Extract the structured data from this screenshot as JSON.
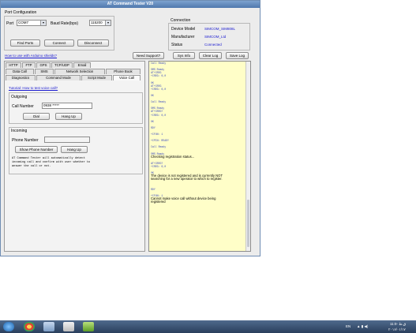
{
  "window": {
    "title": "AT Command Tester V20"
  },
  "port_config": {
    "heading": "Port Configuration",
    "port_label": "Port",
    "port_value": "COM7",
    "baud_label": "Baud Rate(bps)",
    "baud_value": "115200",
    "find_ports": "Find Ports",
    "connect": "Connect",
    "disconnect": "Disconnect"
  },
  "connection": {
    "heading": "Connection",
    "device_model_label": "Device Model",
    "device_model_value": "SIMCOM_SIM808L",
    "manufacturer_label": "Manufacturer",
    "manufacturer_value": "SIMCOM_Ltd",
    "status_label": "Status",
    "status_value": "Connected"
  },
  "toolbar": {
    "arduino_link": "How to use with Arduino shields?",
    "need_support": "Need Support?",
    "sys_info": "Sys Info",
    "clear_log": "Clear Log",
    "save_log": "Save Log"
  },
  "tabs": {
    "row1": [
      "HTTP",
      "FTP",
      "GPS",
      "TCP/UDP",
      "Email"
    ],
    "row2": [
      "Data Call",
      "SMS",
      "Network Selection",
      "Phone Book"
    ],
    "row3": [
      "Diagnostics",
      "Command Mode",
      "Script Mode",
      "Voice Call"
    ]
  },
  "voice_call": {
    "tutorial_link": "Tutorial: How to test voice call?",
    "outgoing_heading": "Outgoing",
    "call_number_label": "Call Number",
    "call_number_value": "0938 *****",
    "dial": "Dial",
    "hang_up": "Hang Up",
    "incoming_heading": "Incoming",
    "phone_number_label": "Phone Number",
    "phone_number_value": "",
    "show_phone_number": "Show Phone Number",
    "hang_up_incoming": "Hang Up",
    "note_1": "AT Command Tester will automatically detect",
    "note_2": "incoming call and confirm with user whether to",
    "note_3": "answer the call or not."
  },
  "log": {
    "lines": [
      {
        "text": "Call Ready",
        "kind": "cmd"
      },
      {
        "text": "",
        "kind": "cmd"
      },
      {
        "text": "SMS Ready",
        "kind": "cmd"
      },
      {
        "text": "AT+CREG",
        "kind": "cmd"
      },
      {
        "text": "+CREG: 0,0",
        "kind": "cmd"
      },
      {
        "text": "",
        "kind": "cmd"
      },
      {
        "text": "OK",
        "kind": "cmd"
      },
      {
        "text": "AT+CREG",
        "kind": "cmd"
      },
      {
        "text": "+CREG: 0,0",
        "kind": "cmd"
      },
      {
        "text": "",
        "kind": "cmd"
      },
      {
        "text": "OK",
        "kind": "cmd"
      },
      {
        "text": "",
        "kind": "cmd"
      },
      {
        "text": "Call Ready",
        "kind": "cmd"
      },
      {
        "text": "",
        "kind": "cmd"
      },
      {
        "text": "SMS Ready",
        "kind": "cmd"
      },
      {
        "text": "AT+CREG?",
        "kind": "cmd"
      },
      {
        "text": "+CREG: 0,0",
        "kind": "cmd"
      },
      {
        "text": "",
        "kind": "cmd"
      },
      {
        "text": "OK",
        "kind": "cmd"
      },
      {
        "text": "",
        "kind": "cmd"
      },
      {
        "text": "RDY",
        "kind": "cmd"
      },
      {
        "text": "",
        "kind": "cmd"
      },
      {
        "text": "+CFUN: 1",
        "kind": "cmd"
      },
      {
        "text": "",
        "kind": "cmd"
      },
      {
        "text": "+CPIN: READY",
        "kind": "cmd"
      },
      {
        "text": "",
        "kind": "cmd"
      },
      {
        "text": "Call Ready",
        "kind": "cmd"
      },
      {
        "text": "",
        "kind": "cmd"
      },
      {
        "text": "SMS Ready",
        "kind": "cmd"
      },
      {
        "text": "Checking registration status...",
        "kind": "msg"
      },
      {
        "text": "",
        "kind": "cmd"
      },
      {
        "text": "AT+CREG?",
        "kind": "cmd"
      },
      {
        "text": "+CREG: 0,0",
        "kind": "cmd"
      },
      {
        "text": "",
        "kind": "cmd"
      },
      {
        "text": "OK",
        "kind": "cmd"
      },
      {
        "text": "The device is not registered and is currently NOT",
        "kind": "msg"
      },
      {
        "text": "searching for a new operator to which to register.",
        "kind": "msg"
      },
      {
        "text": "",
        "kind": "cmd"
      },
      {
        "text": "",
        "kind": "cmd"
      },
      {
        "text": "RDY",
        "kind": "cmd"
      },
      {
        "text": "",
        "kind": "cmd"
      },
      {
        "text": "+CFUN: 1",
        "kind": "cmd"
      },
      {
        "text": "Cannot make voice call without device being",
        "kind": "msg"
      },
      {
        "text": "registered",
        "kind": "msg"
      }
    ]
  },
  "taskbar": {
    "lang": "EN",
    "time": "11:0- ق.ظ",
    "date": "۲۰۱۶/۰۱/۱۷"
  }
}
